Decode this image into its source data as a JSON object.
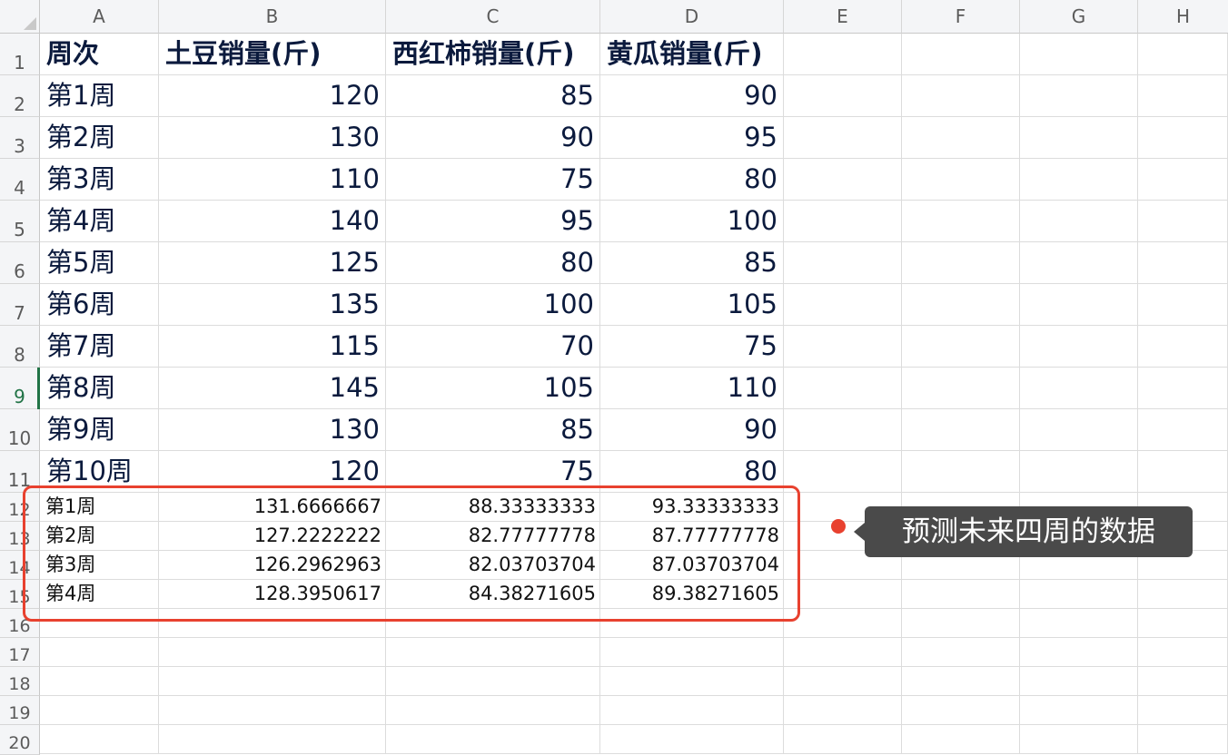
{
  "columns": [
    "A",
    "B",
    "C",
    "D",
    "E",
    "F",
    "G",
    "H"
  ],
  "rows": [
    "1",
    "2",
    "3",
    "4",
    "5",
    "6",
    "7",
    "8",
    "9",
    "10",
    "11",
    "12",
    "13",
    "14",
    "15",
    "16",
    "17",
    "18",
    "19",
    "20"
  ],
  "active_row": "9",
  "table": {
    "headers": [
      "周次",
      "土豆销量(斤)",
      "西红柿销量(斤)",
      "黄瓜销量(斤)"
    ],
    "data": [
      [
        "第1周",
        "120",
        "85",
        "90"
      ],
      [
        "第2周",
        "130",
        "90",
        "95"
      ],
      [
        "第3周",
        "110",
        "75",
        "80"
      ],
      [
        "第4周",
        "140",
        "95",
        "100"
      ],
      [
        "第5周",
        "125",
        "80",
        "85"
      ],
      [
        "第6周",
        "135",
        "100",
        "105"
      ],
      [
        "第7周",
        "115",
        "70",
        "75"
      ],
      [
        "第8周",
        "145",
        "105",
        "110"
      ],
      [
        "第9周",
        "130",
        "85",
        "90"
      ],
      [
        "第10周",
        "120",
        "75",
        "80"
      ]
    ],
    "forecast": [
      [
        "第1周",
        "131.6666667",
        "88.33333333",
        "93.33333333"
      ],
      [
        "第2周",
        "127.2222222",
        "82.77777778",
        "87.77777778"
      ],
      [
        "第3周",
        "126.2962963",
        "82.03703704",
        "87.03703704"
      ],
      [
        "第4周",
        "128.3950617",
        "84.38271605",
        "89.38271605"
      ]
    ]
  },
  "annotation": {
    "text": "预测未来四周的数据",
    "accent_color": "#e8412f",
    "bubble_color": "#4a4a4a"
  },
  "grid_color": "#dcdcdc",
  "header_bg": "#f4f5f7",
  "active_color": "#217346"
}
